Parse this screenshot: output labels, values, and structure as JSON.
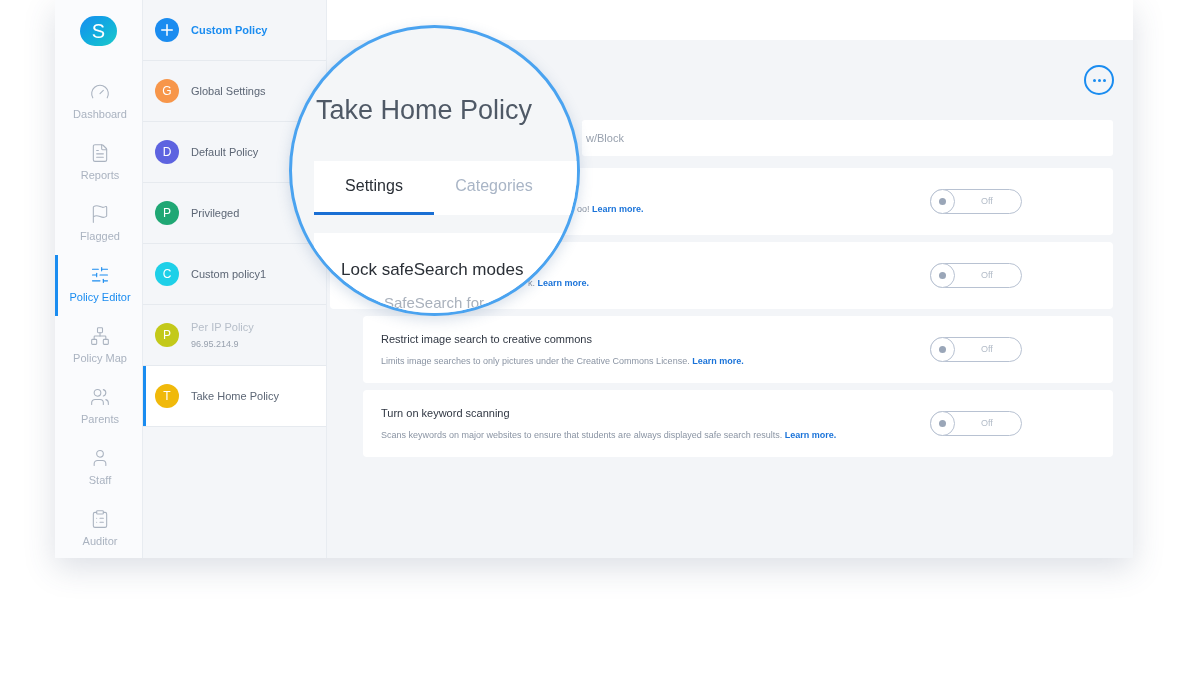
{
  "sidebar": {
    "avatar": "S",
    "items": [
      {
        "label": "Dashboard",
        "selected": false
      },
      {
        "label": "Reports",
        "selected": false
      },
      {
        "label": "Flagged",
        "selected": false
      },
      {
        "label": "Policy Editor",
        "selected": true
      },
      {
        "label": "Policy Map",
        "selected": false
      },
      {
        "label": "Parents",
        "selected": false
      },
      {
        "label": "Staff",
        "selected": false
      },
      {
        "label": "Auditor",
        "selected": false
      }
    ]
  },
  "policies": [
    {
      "kind": "add",
      "name": "Custom Policy",
      "color": "#1a8cf0",
      "selected": false,
      "disabled": false
    },
    {
      "kind": "policy",
      "avatar": "G",
      "name": "Global Settings",
      "color": "#f7964a",
      "selected": false,
      "disabled": false
    },
    {
      "kind": "policy",
      "avatar": "D",
      "name": "Default Policy",
      "color": "#5d63e0",
      "selected": false,
      "disabled": false
    },
    {
      "kind": "policy",
      "avatar": "P",
      "name": "Privileged",
      "color": "#1fa774",
      "selected": false,
      "disabled": false
    },
    {
      "kind": "policy",
      "avatar": "C",
      "name": "Custom policy1",
      "color": "#1ed0e8",
      "selected": false,
      "disabled": false
    },
    {
      "kind": "policy",
      "avatar": "P",
      "name": "Per IP Policy",
      "sub": "96.95.214.9",
      "color": "#c3c91a",
      "selected": false,
      "disabled": true
    },
    {
      "kind": "policy",
      "avatar": "T",
      "name": "Take Home Policy",
      "color": "#f0b90b",
      "selected": true,
      "disabled": false
    }
  ],
  "lens": {
    "title": "Take Home Policy",
    "tabs": [
      {
        "label": "Settings",
        "selected": true
      },
      {
        "label": "Categories",
        "selected": false
      }
    ],
    "setting_title": "Lock safeSearch modes",
    "setting_text": "SafeSearch for"
  },
  "search_field": {
    "placeholder": "w/Block"
  },
  "settings": [
    {
      "text": "oo!",
      "link": "Learn more.",
      "on": false,
      "toggle_label": "Off",
      "nested": false
    },
    {
      "text": "k.",
      "link": "Learn more.",
      "on": false,
      "toggle_label": "Off",
      "nested": false
    },
    {
      "title": "Restrict image search to creative commons",
      "text": "Limits image searches to only pictures under the Creative Commons License.",
      "link": "Learn more.",
      "on": false,
      "toggle_label": "Off",
      "nested": true
    },
    {
      "title": "Turn on keyword scanning",
      "text": "Scans keywords on major websites to ensure that students are always displayed safe search results.",
      "link": "Learn more.",
      "on": false,
      "toggle_label": "Off",
      "nested": true
    }
  ]
}
